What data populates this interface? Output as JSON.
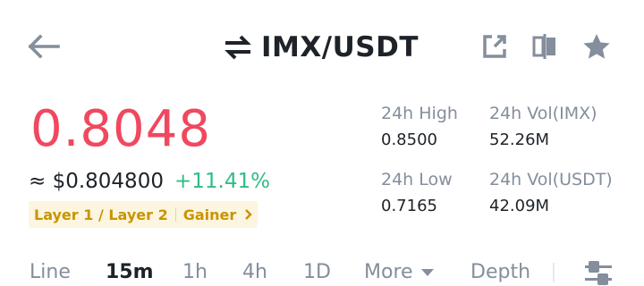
{
  "header": {
    "title": "IMX/USDT",
    "icons": [
      "back-arrow-icon",
      "swap-icon",
      "share-icon",
      "compare-icon",
      "star-icon"
    ]
  },
  "ticker": {
    "price": "0.8048",
    "fiat_price": "≈ $0.804800",
    "change": "+11.41%",
    "price_color": "#f0485f",
    "change_color": "#2ebd85",
    "tags": [
      "Layer 1 / Layer 2",
      "Gainer"
    ]
  },
  "stats": {
    "high_label": "24h High",
    "high_value": "0.8500",
    "low_label": "24h Low",
    "low_value": "0.7165",
    "vol_base_label": "24h Vol(IMX)",
    "vol_base_value": "52.26M",
    "vol_quote_label": "24h Vol(USDT)",
    "vol_quote_value": "42.09M"
  },
  "tabs": {
    "items": [
      "Line",
      "15m",
      "1h",
      "4h",
      "1D",
      "More",
      "Depth"
    ],
    "active": "15m",
    "settings_icon": "sliders-icon"
  },
  "colors": {
    "accent_tag": "#c99400",
    "tag_bg": "#fcf5df",
    "muted": "#848e9c",
    "text": "#1e2329"
  }
}
